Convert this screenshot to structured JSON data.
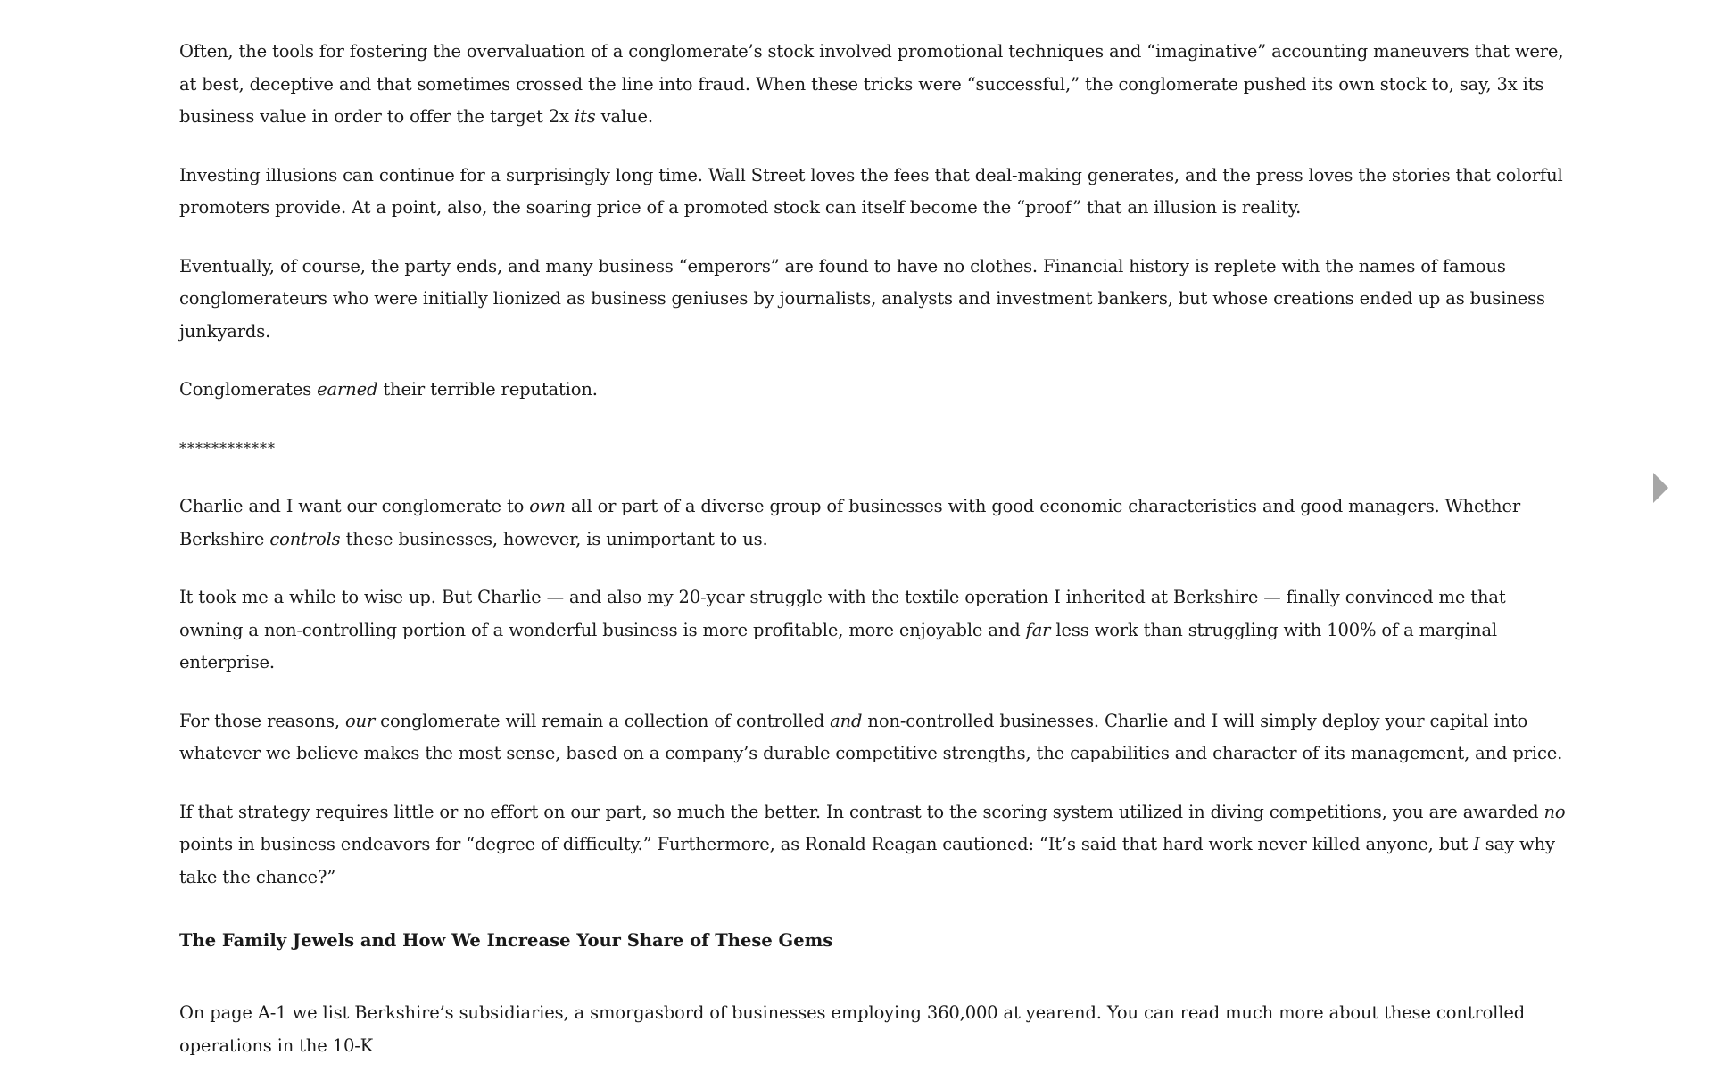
{
  "document": {
    "p1": {
      "a": "Often, the tools for fostering the overvaluation of a conglomerate’s stock involved promotional techniques and “imaginative” accounting maneuvers that were, at best, deceptive and that sometimes crossed the line into fraud. When these tricks were “successful,” the conglomerate pushed its own stock to, say, 3x its business value in order to offer the target 2x ",
      "em": "its",
      "b": " value."
    },
    "p2": "Investing illusions can continue for a surprisingly long time. Wall Street loves the fees that deal-making generates, and the press loves the stories that colorful promoters provide. At a point, also, the soaring price of a promoted stock can itself become the “proof” that an illusion is reality.",
    "p3": "Eventually, of course, the party ends, and many business “emperors” are found to have no clothes. Financial history is replete with the names of famous conglomerateurs who were initially lionized as business geniuses by journalists, analysts and investment bankers, but whose creations ended up as business junkyards.",
    "p4": {
      "a": "Conglomerates ",
      "em": "earned",
      "b": " their terrible reputation."
    },
    "separator": "************",
    "p5": {
      "a": "Charlie and I want our conglomerate to ",
      "em1": "own",
      "b": " all or part of a diverse group of businesses with good economic characteristics and good managers. Whether Berkshire ",
      "em2": "controls",
      "c": " these businesses, however, is unimportant to us."
    },
    "p6": {
      "a": "It took me a while to wise up. But Charlie — and also my 20-year struggle with the textile operation I inherited at Berkshire — finally convinced me that owning a non-controlling portion of a wonderful business is more profitable, more enjoyable and ",
      "em": "far",
      "b": " less work than struggling with 100% of a marginal enterprise."
    },
    "p7": {
      "a": "For those reasons, ",
      "em1": "our",
      "b": " conglomerate will remain a collection of controlled ",
      "em2": "and",
      "c": " non-controlled businesses. Charlie and I will simply deploy your capital into whatever we believe makes the most sense, based on a company’s durable competitive strengths, the capabilities and character of its management, and price."
    },
    "p8": {
      "a": "If that strategy requires little or no effort on our part, so much the better. In contrast to the scoring system utilized in diving competitions, you are awarded ",
      "em1": "no",
      "b": " points in business endeavors for “degree of difficulty.” Furthermore, as Ronald Reagan cautioned: “It’s said that hard work never killed anyone, but ",
      "em2": "I",
      "c": " say why take the chance?”"
    },
    "heading": "The Family Jewels and How We Increase Your Share of These Gems",
    "p9": "On page A-1 we list Berkshire’s subsidiaries, a smorgasbord of businesses employing 360,000 at yearend. You can read much more about these controlled operations in the 10-K"
  },
  "navigation": {
    "next_icon": "chevron-right-triangle-icon",
    "arrow_color": "#a6a6a6"
  }
}
